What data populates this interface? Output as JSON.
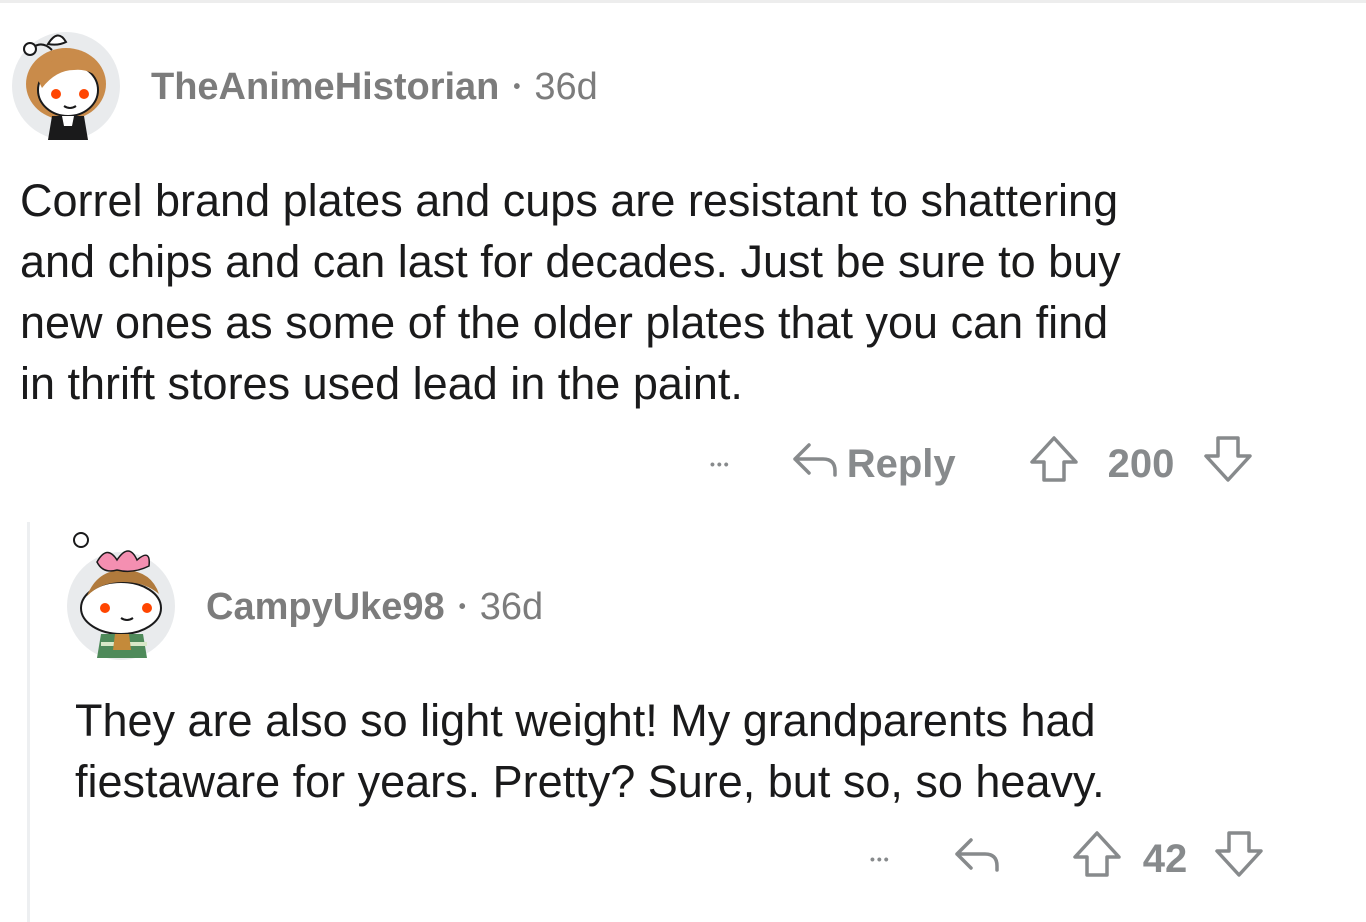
{
  "comment": {
    "username": "TheAnimeHistorian",
    "separator": "•",
    "age": "36d",
    "lines": [
      "Correl brand plates and cups are resistant to shattering",
      "and chips and can last for decades. Just be sure to buy",
      "new ones as some of the older plates that you can find",
      "in thrift stores used lead in the paint."
    ],
    "more_label": "•••",
    "reply_label": "Reply",
    "score": "200"
  },
  "reply_comment": {
    "username": "CampyUke98",
    "separator": "•",
    "age": "36d",
    "lines": [
      "They are also so light weight! My grandparents had",
      "fiestaware for years. Pretty? Sure, but so, so heavy."
    ],
    "more_label": "•••",
    "score": "42"
  },
  "icons": {
    "reply": "reply-arrow-icon",
    "upvote": "upvote-arrow-icon",
    "downvote": "downvote-arrow-icon"
  }
}
